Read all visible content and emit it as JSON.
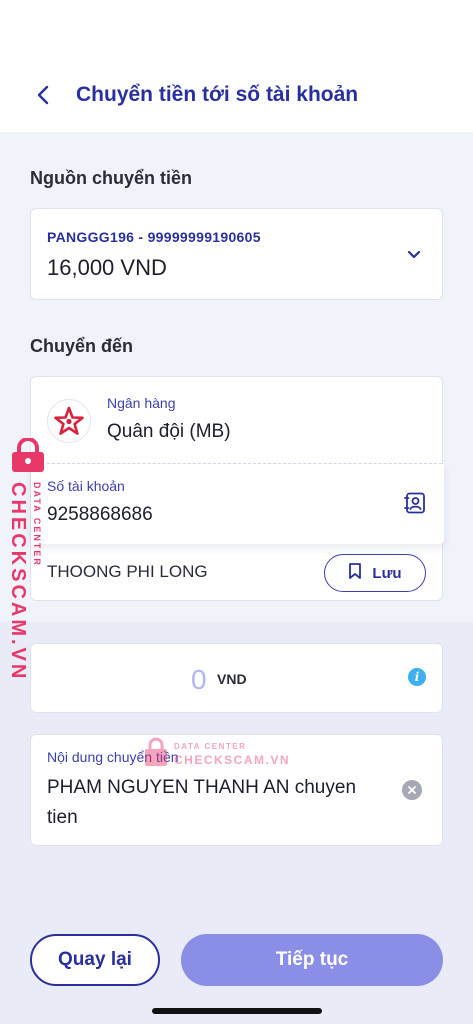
{
  "header": {
    "title": "Chuyển tiền tới số tài khoản"
  },
  "source": {
    "section_label": "Nguồn chuyển tiền",
    "account_line": "PANGGG196 - 99999999190605",
    "balance": "16,000 VND"
  },
  "destination": {
    "section_label": "Chuyển đến",
    "bank_label": "Ngân hàng",
    "bank_name": "Quân đội (MB)",
    "account_label": "Số tài khoản",
    "account_number": "9258868686",
    "recipient_name": "THOONG PHI LONG",
    "save_label": "Lưu"
  },
  "amount": {
    "value": "0",
    "unit": "VND"
  },
  "content": {
    "label": "Nội dung chuyển tiền",
    "text": "PHAM NGUYEN THANH AN chuyen tien"
  },
  "actions": {
    "back_label": "Quay lại",
    "next_label": "Tiếp tục"
  },
  "watermark": {
    "brand": "CHECKSCAM.VN",
    "subtitle": "DATA CENTER"
  },
  "colors": {
    "primary": "#2a2f9e",
    "next_button": "#8b8ee6",
    "bank_logo": "#d7233c",
    "watermark": "#e8386a",
    "info": "#3fb0ef"
  }
}
